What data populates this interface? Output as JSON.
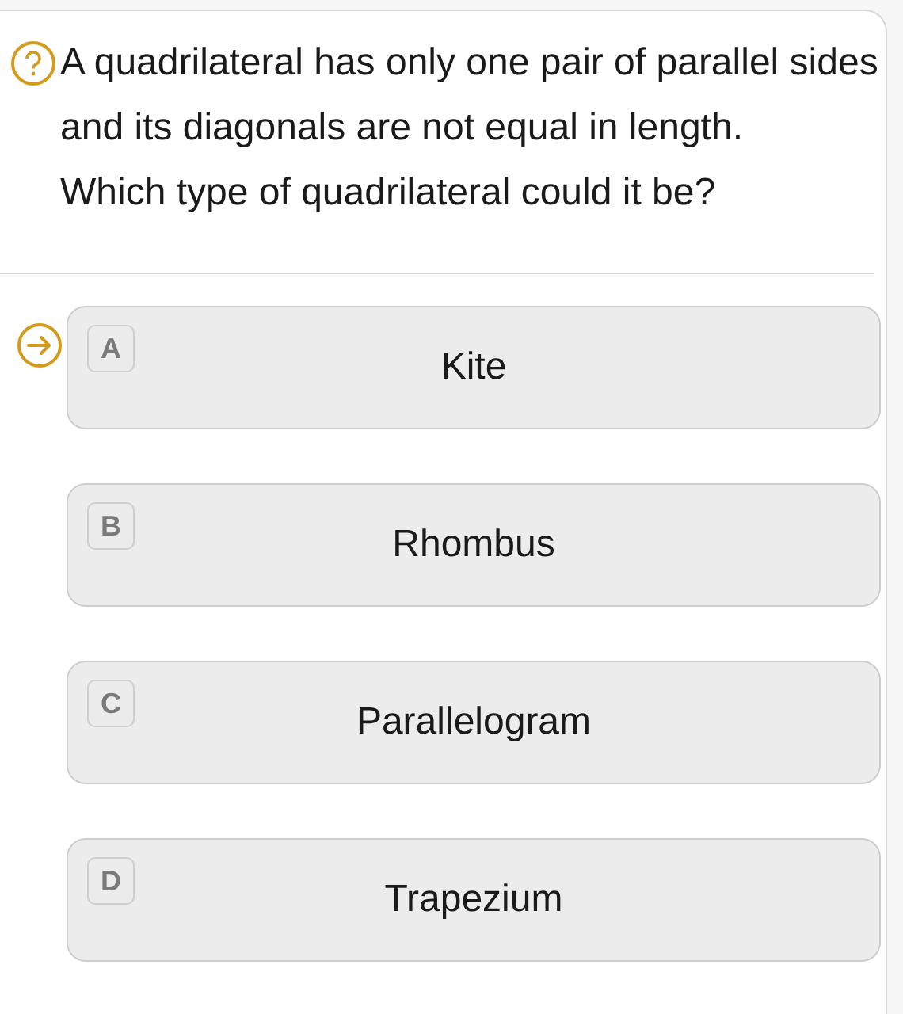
{
  "question": {
    "text": "A quadrilateral has only one pair of parallel sides and its diagonals are not equal in length.\nWhich type of quadrilateral could it be?"
  },
  "options": [
    {
      "letter": "A",
      "label": "Kite",
      "selected": true
    },
    {
      "letter": "B",
      "label": "Rhombus",
      "selected": false
    },
    {
      "letter": "C",
      "label": "Parallelogram",
      "selected": false
    },
    {
      "letter": "D",
      "label": "Trapezium",
      "selected": false
    }
  ]
}
